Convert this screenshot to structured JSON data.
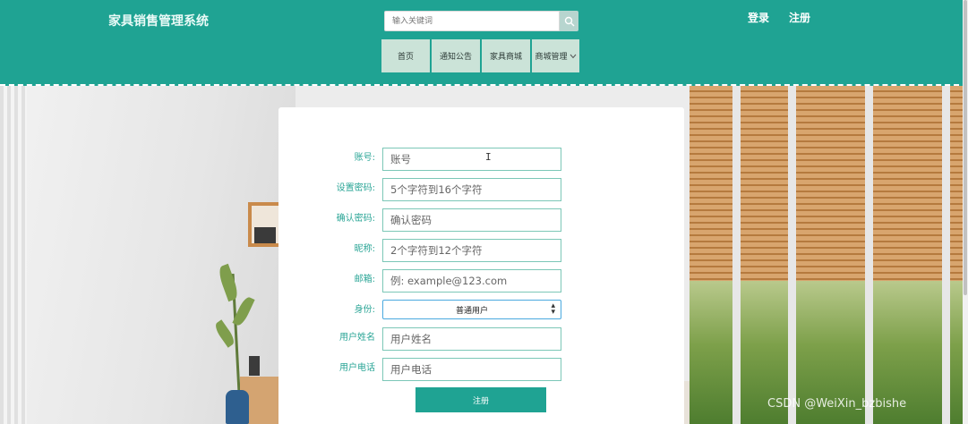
{
  "header": {
    "brand": "家具销售管理系统",
    "search_placeholder": "输入关键词",
    "search_icon": "search-icon",
    "login": "登录",
    "register": "注册",
    "nav": [
      {
        "label": "首页"
      },
      {
        "label": "通知公告"
      },
      {
        "label": "家具商城"
      },
      {
        "label": "商城管理"
      }
    ]
  },
  "form": {
    "fields": [
      {
        "label": "账号:",
        "placeholder": "账号"
      },
      {
        "label": "设置密码:",
        "placeholder": "5个字符到16个字符"
      },
      {
        "label": "确认密码:",
        "placeholder": "确认密码"
      },
      {
        "label": "昵称:",
        "placeholder": "2个字符到12个字符"
      },
      {
        "label": "邮箱:",
        "placeholder": "例: example@123.com"
      }
    ],
    "role": {
      "label": "身份:",
      "selected": "普通用户"
    },
    "name": {
      "label": "用户姓名",
      "placeholder": "用户姓名"
    },
    "phone": {
      "label": "用户电话",
      "placeholder": "用户电话"
    },
    "submit": "注册"
  },
  "watermark": "CSDN @WeiXin_bzbishe",
  "colors": {
    "primary": "#1fa393",
    "nav_bg": "#cbe3d8",
    "label": "#2aa596"
  }
}
